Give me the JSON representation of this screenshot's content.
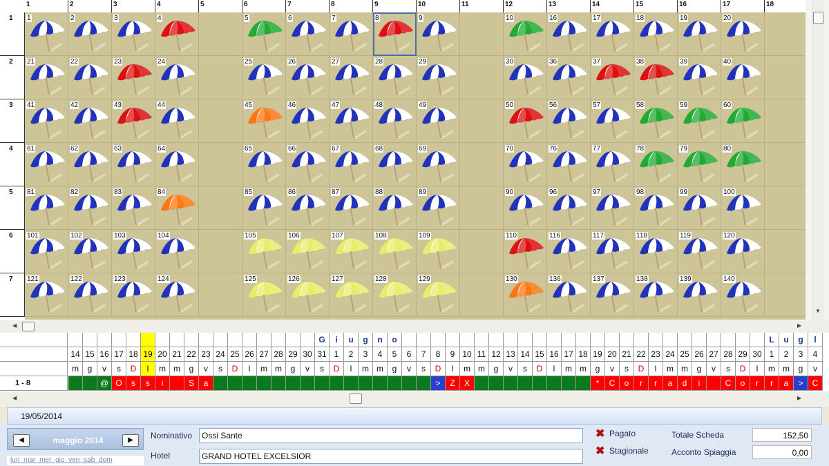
{
  "columns": [
    "1",
    "2",
    "3",
    "4",
    "5",
    "6",
    "7",
    "8",
    "9",
    "10",
    "11",
    "12",
    "13",
    "14",
    "15",
    "16",
    "17",
    "18"
  ],
  "rows": [
    "1",
    "2",
    "3",
    "4",
    "5",
    "6",
    "7"
  ],
  "umbrella_colors": {
    "blue": "#2233bb",
    "red": "#dd1111",
    "green": "#22aa33",
    "orange": "#ff7711",
    "yellow": "#e7ec6a",
    "pole": "#b8a178"
  },
  "grid": [
    [
      {
        "n": "1",
        "c": "blue"
      },
      {
        "n": "2",
        "c": "blue"
      },
      {
        "n": "3",
        "c": "blue"
      },
      {
        "n": "4",
        "c": "red"
      },
      null,
      {
        "n": "5",
        "c": "green"
      },
      {
        "n": "6",
        "c": "blue"
      },
      {
        "n": "7",
        "c": "blue"
      },
      {
        "n": "8",
        "c": "red",
        "sel": true
      },
      {
        "n": "9",
        "c": "blue"
      },
      null,
      {
        "n": "10",
        "c": "green"
      },
      {
        "n": "16",
        "c": "blue"
      },
      {
        "n": "17",
        "c": "blue"
      },
      {
        "n": "18",
        "c": "blue"
      },
      {
        "n": "19",
        "c": "blue"
      },
      {
        "n": "20",
        "c": "blue"
      },
      null
    ],
    [
      {
        "n": "21",
        "c": "blue"
      },
      {
        "n": "22",
        "c": "blue"
      },
      {
        "n": "23",
        "c": "red"
      },
      {
        "n": "24",
        "c": "blue"
      },
      null,
      {
        "n": "25",
        "c": "blue"
      },
      {
        "n": "26",
        "c": "blue"
      },
      {
        "n": "27",
        "c": "blue"
      },
      {
        "n": "28",
        "c": "blue"
      },
      {
        "n": "29",
        "c": "blue"
      },
      null,
      {
        "n": "30",
        "c": "blue"
      },
      {
        "n": "36",
        "c": "blue"
      },
      {
        "n": "37",
        "c": "red"
      },
      {
        "n": "38",
        "c": "red"
      },
      {
        "n": "39",
        "c": "blue"
      },
      {
        "n": "40",
        "c": "blue"
      },
      null
    ],
    [
      {
        "n": "41",
        "c": "blue"
      },
      {
        "n": "42",
        "c": "blue"
      },
      {
        "n": "43",
        "c": "red"
      },
      {
        "n": "44",
        "c": "blue"
      },
      null,
      {
        "n": "45",
        "c": "orange"
      },
      {
        "n": "46",
        "c": "blue"
      },
      {
        "n": "47",
        "c": "blue"
      },
      {
        "n": "48",
        "c": "blue"
      },
      {
        "n": "49",
        "c": "blue"
      },
      null,
      {
        "n": "50",
        "c": "red"
      },
      {
        "n": "56",
        "c": "blue"
      },
      {
        "n": "57",
        "c": "blue"
      },
      {
        "n": "58",
        "c": "green"
      },
      {
        "n": "59",
        "c": "green"
      },
      {
        "n": "60",
        "c": "green"
      },
      null
    ],
    [
      {
        "n": "61",
        "c": "blue"
      },
      {
        "n": "62",
        "c": "blue"
      },
      {
        "n": "63",
        "c": "blue"
      },
      {
        "n": "64",
        "c": "blue"
      },
      null,
      {
        "n": "65",
        "c": "blue"
      },
      {
        "n": "66",
        "c": "blue"
      },
      {
        "n": "67",
        "c": "blue"
      },
      {
        "n": "68",
        "c": "blue"
      },
      {
        "n": "69",
        "c": "blue"
      },
      null,
      {
        "n": "70",
        "c": "blue"
      },
      {
        "n": "76",
        "c": "blue"
      },
      {
        "n": "77",
        "c": "blue"
      },
      {
        "n": "78",
        "c": "green"
      },
      {
        "n": "79",
        "c": "green"
      },
      {
        "n": "80",
        "c": "green"
      },
      null
    ],
    [
      {
        "n": "81",
        "c": "blue"
      },
      {
        "n": "82",
        "c": "blue"
      },
      {
        "n": "83",
        "c": "blue"
      },
      {
        "n": "84",
        "c": "orange"
      },
      null,
      {
        "n": "85",
        "c": "blue"
      },
      {
        "n": "86",
        "c": "blue"
      },
      {
        "n": "87",
        "c": "blue"
      },
      {
        "n": "88",
        "c": "blue"
      },
      {
        "n": "89",
        "c": "blue"
      },
      null,
      {
        "n": "90",
        "c": "blue"
      },
      {
        "n": "96",
        "c": "blue"
      },
      {
        "n": "97",
        "c": "blue"
      },
      {
        "n": "98",
        "c": "blue"
      },
      {
        "n": "99",
        "c": "blue"
      },
      {
        "n": "100",
        "c": "blue"
      },
      null
    ],
    [
      {
        "n": "101",
        "c": "blue"
      },
      {
        "n": "102",
        "c": "blue"
      },
      {
        "n": "103",
        "c": "blue"
      },
      {
        "n": "104",
        "c": "blue"
      },
      null,
      {
        "n": "105",
        "c": "yellow"
      },
      {
        "n": "106",
        "c": "yellow"
      },
      {
        "n": "107",
        "c": "yellow"
      },
      {
        "n": "108",
        "c": "yellow"
      },
      {
        "n": "109",
        "c": "yellow"
      },
      null,
      {
        "n": "110",
        "c": "red"
      },
      {
        "n": "116",
        "c": "blue"
      },
      {
        "n": "117",
        "c": "blue"
      },
      {
        "n": "118",
        "c": "blue"
      },
      {
        "n": "119",
        "c": "blue"
      },
      {
        "n": "120",
        "c": "blue"
      },
      null
    ],
    [
      {
        "n": "121",
        "c": "blue"
      },
      {
        "n": "122",
        "c": "blue"
      },
      {
        "n": "123",
        "c": "blue"
      },
      {
        "n": "124",
        "c": "blue"
      },
      null,
      {
        "n": "125",
        "c": "yellow"
      },
      {
        "n": "126",
        "c": "yellow"
      },
      {
        "n": "127",
        "c": "yellow"
      },
      {
        "n": "128",
        "c": "yellow"
      },
      {
        "n": "129",
        "c": "yellow"
      },
      null,
      {
        "n": "130",
        "c": "orange"
      },
      {
        "n": "136",
        "c": "blue"
      },
      {
        "n": "137",
        "c": "blue"
      },
      {
        "n": "138",
        "c": "blue"
      },
      {
        "n": "139",
        "c": "blue"
      },
      {
        "n": "140",
        "c": "blue"
      },
      null
    ]
  ],
  "calendar": {
    "month_row": [
      "",
      "",
      "",
      "",
      "",
      "",
      "",
      "",
      "",
      "",
      "",
      "",
      "",
      "",
      "",
      "",
      "",
      "G",
      "i",
      "u",
      "g",
      "n",
      "o",
      "",
      "",
      "",
      "",
      "",
      "",
      "",
      "",
      "",
      "",
      "",
      "",
      "",
      "",
      "",
      "",
      "",
      "",
      "",
      "",
      "",
      "",
      "",
      "",
      "",
      "L",
      "u",
      "g",
      "l"
    ],
    "day_row": [
      "14",
      "15",
      "16",
      "17",
      "18",
      "19",
      "20",
      "21",
      "22",
      "23",
      "24",
      "25",
      "26",
      "27",
      "28",
      "29",
      "30",
      "31",
      "1",
      "2",
      "3",
      "4",
      "5",
      "6",
      "7",
      "8",
      "9",
      "10",
      "11",
      "12",
      "13",
      "14",
      "15",
      "16",
      "17",
      "18",
      "19",
      "20",
      "21",
      "22",
      "23",
      "24",
      "25",
      "26",
      "27",
      "28",
      "29",
      "30",
      "1",
      "2",
      "3",
      "4"
    ],
    "weekday_row": [
      "m",
      "g",
      "v",
      "s",
      "D",
      "l",
      "m",
      "m",
      "g",
      "v",
      "s",
      "D",
      "l",
      "m",
      "m",
      "g",
      "v",
      "s",
      "D",
      "l",
      "m",
      "m",
      "g",
      "v",
      "s",
      "D",
      "l",
      "m",
      "m",
      "g",
      "v",
      "s",
      "D",
      "l",
      "m",
      "m",
      "g",
      "v",
      "s",
      "D",
      "l",
      "m",
      "m",
      "g",
      "v",
      "s",
      "D",
      "l",
      "m",
      "m",
      "g",
      "v"
    ],
    "highlight_index": 5,
    "sunday_color": "#cc0000",
    "occupancy_label": "1 - 8",
    "occupancy": [
      {
        "t": "",
        "k": "g"
      },
      {
        "t": "",
        "k": "g"
      },
      {
        "t": "@",
        "k": "g"
      },
      {
        "t": "O",
        "k": "r"
      },
      {
        "t": "s",
        "k": "r"
      },
      {
        "t": "s",
        "k": "r"
      },
      {
        "t": "i",
        "k": "r"
      },
      {
        "t": "",
        "k": "r"
      },
      {
        "t": "S",
        "k": "r"
      },
      {
        "t": "a",
        "k": "r"
      },
      {
        "t": "",
        "k": "g"
      },
      {
        "t": "",
        "k": "g"
      },
      {
        "t": "",
        "k": "g"
      },
      {
        "t": "",
        "k": "g"
      },
      {
        "t": "",
        "k": "g"
      },
      {
        "t": "",
        "k": "g"
      },
      {
        "t": "",
        "k": "g"
      },
      {
        "t": "",
        "k": "g"
      },
      {
        "t": "",
        "k": "g"
      },
      {
        "t": "",
        "k": "g"
      },
      {
        "t": "",
        "k": "g"
      },
      {
        "t": "",
        "k": "g"
      },
      {
        "t": "",
        "k": "g"
      },
      {
        "t": "",
        "k": "g"
      },
      {
        "t": "",
        "k": "g"
      },
      {
        "t": ">",
        "k": "b"
      },
      {
        "t": "Z",
        "k": "r"
      },
      {
        "t": "X",
        "k": "r"
      },
      {
        "t": "",
        "k": "g"
      },
      {
        "t": "",
        "k": "g"
      },
      {
        "t": "",
        "k": "g"
      },
      {
        "t": "",
        "k": "g"
      },
      {
        "t": "",
        "k": "g"
      },
      {
        "t": "",
        "k": "g"
      },
      {
        "t": "",
        "k": "g"
      },
      {
        "t": "",
        "k": "g"
      },
      {
        "t": "*",
        "k": "r"
      },
      {
        "t": "C",
        "k": "r"
      },
      {
        "t": "o",
        "k": "r"
      },
      {
        "t": "r",
        "k": "r"
      },
      {
        "t": "r",
        "k": "r"
      },
      {
        "t": "a",
        "k": "r"
      },
      {
        "t": "d",
        "k": "r"
      },
      {
        "t": "i",
        "k": "r"
      },
      {
        "t": "",
        "k": "r"
      },
      {
        "t": "C",
        "k": "r"
      },
      {
        "t": "o",
        "k": "r"
      },
      {
        "t": "r",
        "k": "r"
      },
      {
        "t": "r",
        "k": "r"
      },
      {
        "t": "a",
        "k": "r"
      },
      {
        "t": ">",
        "k": "b"
      },
      {
        "t": "C",
        "k": "r"
      }
    ]
  },
  "date_bar": "19/05/2014",
  "mini_calendar": {
    "prev_icon": "◀",
    "next_icon": "▶",
    "month_label": "maggio 2014",
    "weekdays": "lun mar mer gio ven sab dom"
  },
  "form": {
    "nominativo_label": "Nominativo",
    "nominativo_value": "Ossi Sante",
    "hotel_label": "Hotel",
    "hotel_value": "GRAND HOTEL EXCELSIOR",
    "pagato_label": "Pagato",
    "stagionale_label": "Stagionale",
    "totale_label": "Totale Scheda",
    "totale_value": "152,50",
    "acconto_label": "Acconto Spiaggia",
    "acconto_value": "0,00"
  }
}
